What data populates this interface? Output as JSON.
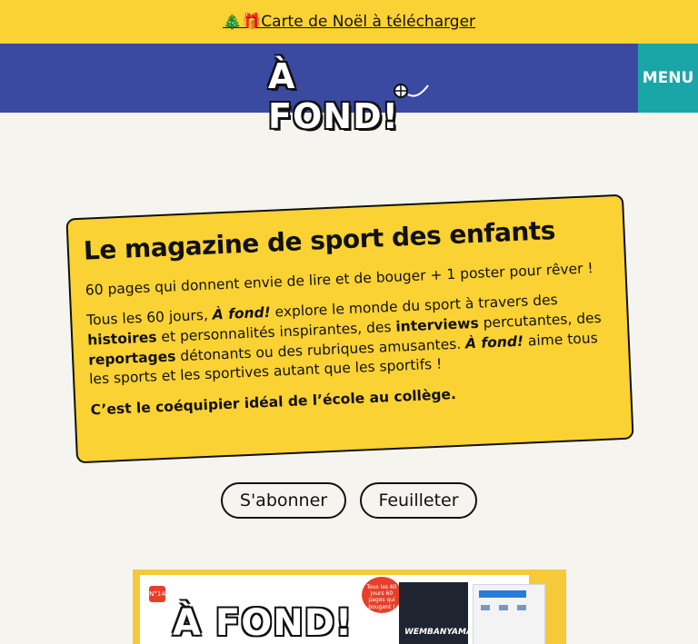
{
  "announcement": {
    "icons": "🎄🎁",
    "link_text": "Carte de Noël à télécharger"
  },
  "header": {
    "logo_text": "À FOND!",
    "menu_label": "MENU"
  },
  "hero": {
    "title": "Le magazine de sport des enfants",
    "tagline": "60 pages qui donnent envie de lire et de bouger + 1 poster pour rêver !",
    "body": {
      "t1": "Tous les 60 jours, ",
      "brand1": "À fond!",
      "t2": " explore le monde du sport à travers des ",
      "b1": "histoires",
      "t3": " et personnalités inspirantes, des ",
      "b2": "interviews",
      "t4": " percutantes, des ",
      "b3": "reportages",
      "t5": " détonants ou des rubriques amusantes. ",
      "brand2": "À fond!",
      "t6": " aime tous les sports et les sportives autant que les sportifs !"
    },
    "conclusion": "C’est le coéquipier idéal de l’école au collège."
  },
  "actions": {
    "subscribe_label": "S'abonner",
    "browse_label": "Feuilleter"
  },
  "cover": {
    "issue_badge": "N°14",
    "logo_text": "À FOND!",
    "bubble_text": "Tous les 60 jours 60 pages qui bougent !",
    "photo_caption": "WEMBANYAMA"
  },
  "colors": {
    "yellow": "#fbd233",
    "header_blue": "#3a4aa0",
    "menu_teal": "#1aa6a8",
    "background": "#f5f4ee"
  }
}
